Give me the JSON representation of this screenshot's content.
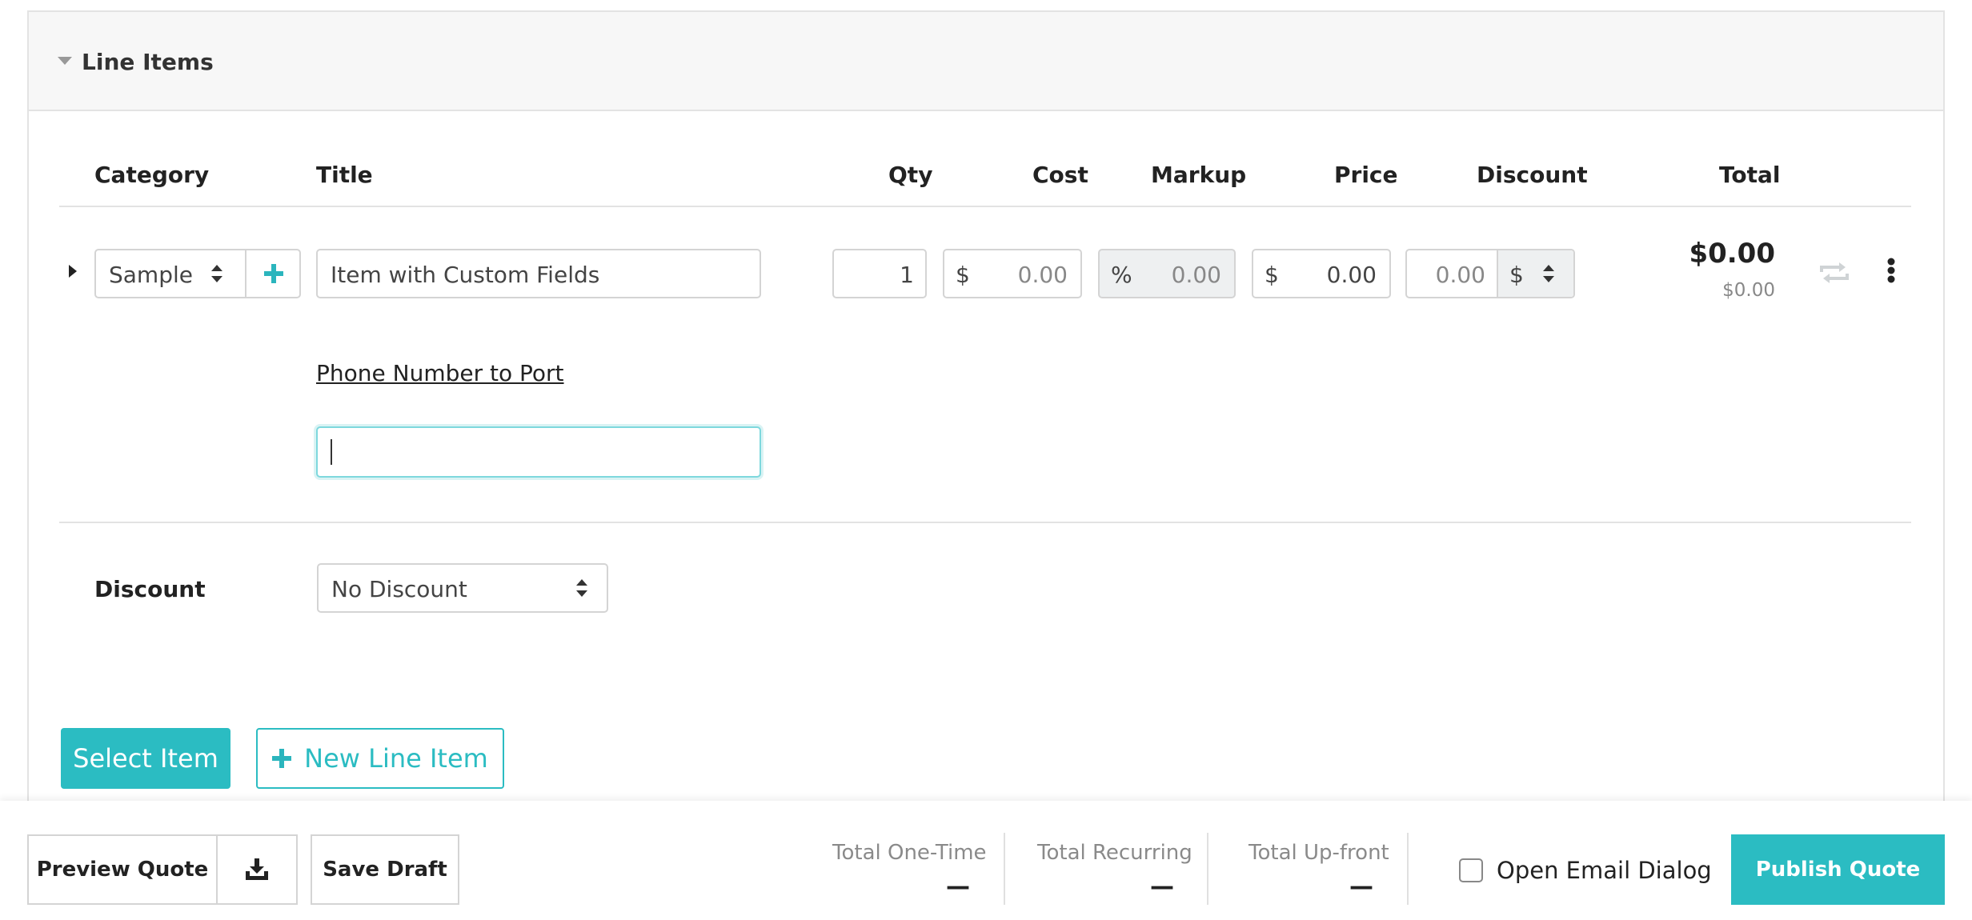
{
  "section": {
    "title": "Line Items"
  },
  "columns": {
    "category": "Category",
    "title": "Title",
    "qty": "Qty",
    "cost": "Cost",
    "markup": "Markup",
    "price": "Price",
    "discount": "Discount",
    "total": "Total"
  },
  "line_item": {
    "category": "Sample",
    "title": "Item with Custom Fields",
    "qty": "1",
    "cost_symbol": "$",
    "cost": "0.00",
    "markup_symbol": "%",
    "markup": "0.00",
    "price_symbol": "$",
    "price": "0.00",
    "discount": "0.00",
    "discount_symbol": "$",
    "total": "$0.00",
    "total_sub": "$0.00",
    "custom_field_label": "Phone Number to Port",
    "custom_field_value": ""
  },
  "discount": {
    "label": "Discount",
    "selected": "No Discount"
  },
  "actions": {
    "select_item": "Select Item",
    "new_line_item": "New Line Item"
  },
  "footer": {
    "preview_quote": "Preview Quote",
    "save_draft": "Save Draft",
    "totals": [
      {
        "label": "Total One-Time",
        "value": "—"
      },
      {
        "label": "Total Recurring",
        "value": "—"
      },
      {
        "label": "Total Up-front",
        "value": "—"
      }
    ],
    "open_email_dialog": "Open Email Dialog",
    "open_email_dialog_checked": false,
    "publish_quote": "Publish Quote"
  },
  "colors": {
    "accent": "#2bbcc2",
    "border": "#d4d4d4",
    "header_bg": "#f7f7f7",
    "readonly_bg": "#eef0f1"
  }
}
